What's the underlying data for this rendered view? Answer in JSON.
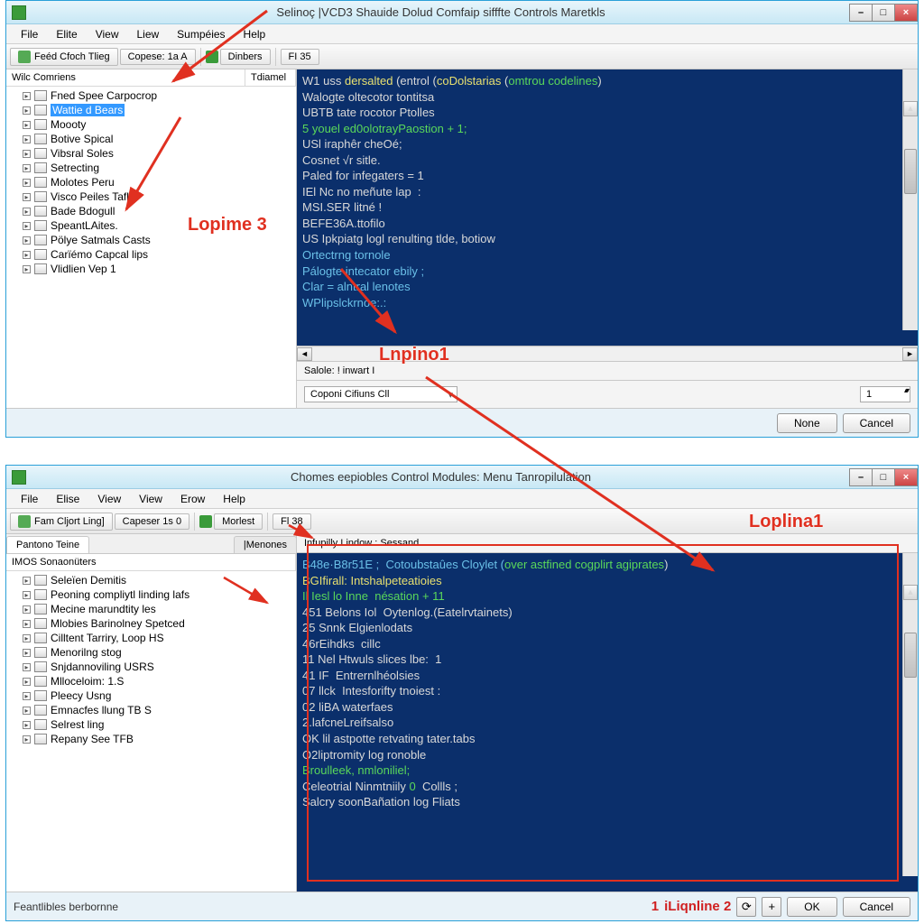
{
  "top": {
    "title": "Selinoç |VCD3 Shauide Dolud Comfaip sifffte Controls Maretkls",
    "menu": [
      "File",
      "Elite",
      "View",
      "Liew",
      "Sumpéies",
      "Help"
    ],
    "toolbar": {
      "b1": "Feéd Cfoch Tlieg",
      "b2": "Copese: 1a A",
      "b3": "Dinbers",
      "b4": "FI 35"
    },
    "treeHeader": {
      "c1": "Wilc Comriens",
      "c2": "Tdiamel"
    },
    "tree": [
      "Fned Spee Carpocrop",
      "Wattie d Bears",
      "Moooty",
      "Botive Spical",
      "Vibsral Soles",
      "Setrecting",
      "Molotes Peru",
      "Visco Peiles Tafl",
      "Bade Bdogull",
      "SpeantLAites.",
      "Pölye Satmals Casts",
      "Carïémo Capcal lips",
      "Vlidlien Vep 1"
    ],
    "treeSelected": 1,
    "status": "Salole: ! inwart I",
    "combo": "Coponi Cifiuns Cll",
    "spin": "1",
    "btnNone": "None",
    "btnCancel": "Cancel",
    "consoleLines": [
      [
        "W1 uss ",
        "dersalted ",
        "(entrol (",
        "coDolstarias ",
        "(",
        "omtrou codelines",
        ")"
      ],
      [
        "Walogte oltecotor tontitsa"
      ],
      [
        "UBTB tate rocotor Ptolles"
      ],
      [
        "5 youel ed0olotrayPaostion + 1;"
      ],
      [
        "USl iraphêr cheOé;"
      ],
      [
        "Cosnet √r sitle."
      ],
      [
        "Paled for infegaters = 1"
      ],
      [
        "IEl Nc no meñute lap  :"
      ],
      [
        "MSI.SER litné !"
      ],
      [
        "BEFE36A.ttofilo"
      ],
      [
        "US Ipkpiatg logl renulting tlde, botiow"
      ],
      [
        ""
      ],
      [
        "Ortectrng tornole"
      ],
      [
        "Pálogte intecator ebily ;"
      ],
      [
        "Clar = alntral lenotes"
      ],
      [
        "WPlipslckrnoe:.:"
      ]
    ]
  },
  "bottom": {
    "title": "Chomes eepiobles Control Modules: Menu Tanropilulation",
    "menu": [
      "File",
      "Elise",
      "View",
      "View",
      "Erow",
      "Help"
    ],
    "toolbar": {
      "b1": "Fam Cljort Ling]",
      "b2": "Capeser 1s 0",
      "b3": "Morlest",
      "b4": "Fl 38"
    },
    "tabStatus": "Infupilly Lindow : Sessand",
    "sideTabs": {
      "t1": "Pantono Teine",
      "t2": "|Menones"
    },
    "treeHeader": "IMOS Sonaonüters",
    "tree": [
      "Seleïen Demitis",
      "Peoning compliytl linding lafs",
      "Mecine marundtity les",
      "Mlobies Barinolney Spetced",
      "Cilltent Tarriry, Loop HS",
      "Menorilng stog",
      "Snjdannoviling USRS",
      "Mlloceloim: 1.S",
      "Pleecy Usng",
      "Emnacfes llung TB S",
      "Selrest ling",
      "Repany See TFB"
    ],
    "consoleLines": [
      [
        "B48e·B8r51E ;  Cotoubstaûes Cloylet (",
        "over astfined cogplirt agiprates",
        ")"
      ],
      [
        "BGIfirall: Intshalpeteatioies"
      ],
      [
        "Il Iesl lo Inne  nésation + 11"
      ],
      [
        "451 Belons Iol  Oytenlog.(Eatelrvtainets)"
      ],
      [
        "25 Snnk Elgienlodats"
      ],
      [
        "46rEihdks  cillc"
      ],
      [
        "11 Nel Htwuls slices lbe:  1"
      ],
      [
        "41 IF  Entrernlhéolsies"
      ],
      [
        "07 llck  Intesforifty tnoiest :"
      ],
      [
        "02 liBA waterfaes"
      ],
      [
        "2.lafcneLreifsalso"
      ],
      [
        "OK lil astpotte retvating tater.tabs"
      ],
      [
        "O2liptromity log ronoble"
      ],
      [
        ""
      ],
      [
        "Broulleek, nmloniliel;"
      ],
      [
        "Celeotrial Ninmtniily ",
        "0",
        "  Collls ;"
      ],
      [
        "Salcry soonBañation log Fliats"
      ]
    ],
    "footNote": "Feantlibles berbornne",
    "btnOK": "OK",
    "btnCancel": "Cancel"
  },
  "annotations": {
    "a1": "Lopime 3",
    "a2": "Lnpino1",
    "a3": "Loplina1",
    "a4": "iLiqnline 2",
    "n1": "1"
  }
}
